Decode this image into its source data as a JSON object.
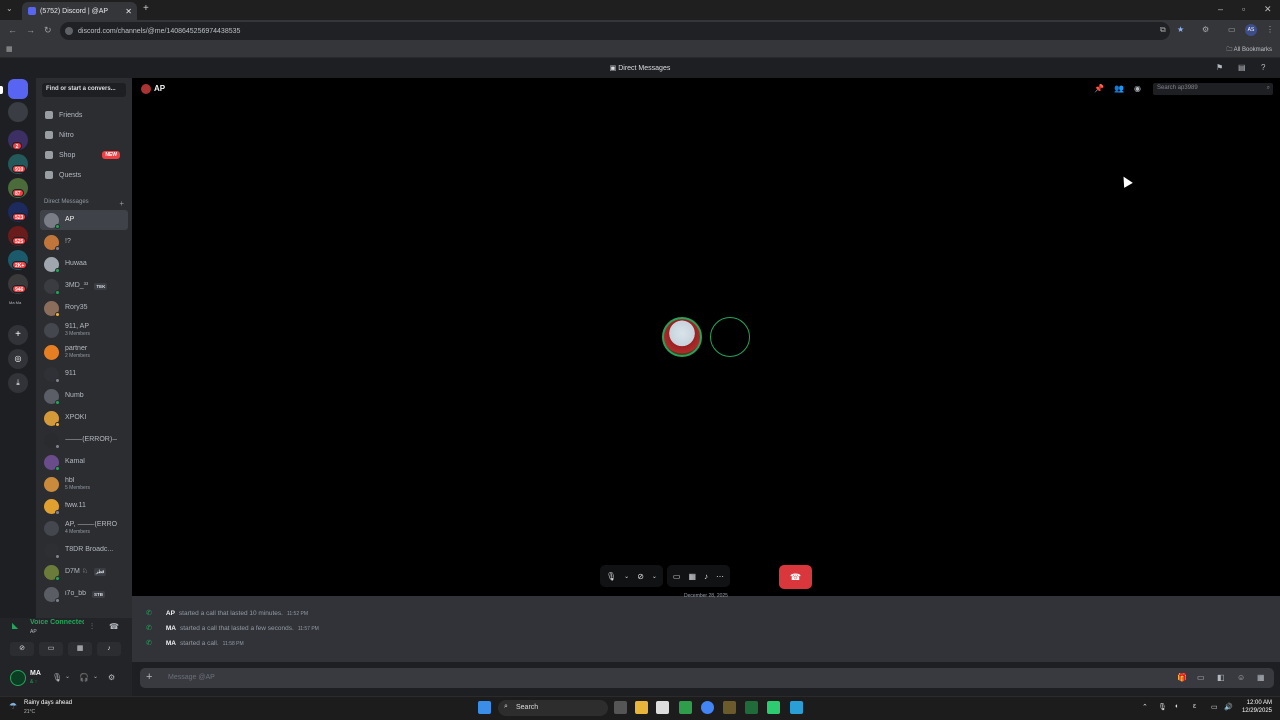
{
  "browser": {
    "tab_title": "(5752) Discord | @AP",
    "url": "discord.com/channels/@me/1408645256974438535",
    "all_bookmarks": "All Bookmarks",
    "profile_initials": "AS"
  },
  "discord": {
    "top_title": "Direct Messages",
    "find_placeholder": "Find or start a convers...",
    "nav": [
      {
        "label": "Friends"
      },
      {
        "label": "Nitro"
      },
      {
        "label": "Shop",
        "badge": "NEW"
      },
      {
        "label": "Quests"
      }
    ],
    "dm_header": "Direct Messages",
    "dm_plus": "+",
    "server_badges": [
      "2",
      "910",
      "87",
      "523",
      "525",
      "2K+",
      "946"
    ],
    "server_tiny_label": "Ma  Ma",
    "dms": [
      {
        "name": "AP",
        "sub": "",
        "tag": "",
        "color": "#7a7d86",
        "selected": true
      },
      {
        "name": "!?",
        "sub": "",
        "tag": "",
        "color": "#c0763a"
      },
      {
        "name": "Huwaa",
        "sub": "",
        "tag": "",
        "color": "#9fa6ad"
      },
      {
        "name": "3MD_³³",
        "sub": "",
        "tag": "TEK",
        "color": "#3a3c42"
      },
      {
        "name": "Rory35",
        "sub": "",
        "tag": "",
        "color": "#8a6d5a"
      },
      {
        "name": "911, AP",
        "sub": "3 Members",
        "tag": "",
        "color": "#44474e"
      },
      {
        "name": "partner",
        "sub": "2 Members",
        "tag": "",
        "color": "#e67e22"
      },
      {
        "name": "911",
        "sub": "",
        "tag": "",
        "color": "#2f3136"
      },
      {
        "name": "Numb",
        "sub": "",
        "tag": "",
        "color": "#5b5e66"
      },
      {
        "name": "XPOKI",
        "sub": "",
        "tag": "",
        "color": "#d49a3a"
      },
      {
        "name": "⸻(ERROR)⸻",
        "sub": "",
        "tag": "",
        "color": "#2a2b2f"
      },
      {
        "name": "Kamal",
        "sub": "",
        "tag": "",
        "color": "#6a4c8a"
      },
      {
        "name": "hbl",
        "sub": "5 Members",
        "tag": "",
        "color": "#c98a3c"
      },
      {
        "name": "fww.11",
        "sub": "",
        "tag": "",
        "color": "#e0a030"
      },
      {
        "name": "AP, ⸻(ERRO...",
        "sub": "4 Members",
        "tag": "",
        "color": "#44474e"
      },
      {
        "name": "T8DR Broadc...",
        "sub": "",
        "tag": "",
        "color": "#2e2f33"
      },
      {
        "name": "D7M ♘",
        "sub": "",
        "tag": "قطر",
        "color": "#6b7c3a"
      },
      {
        "name": "i7o_bb",
        "sub": "",
        "tag": "STB",
        "color": "#5a5d63"
      }
    ],
    "voice": {
      "status": "Voice Connected",
      "sub": "AP"
    },
    "user": {
      "name": "MA",
      "sub": "& ↑"
    },
    "channel": {
      "title": "AP",
      "search_placeholder": "Search ap3989"
    },
    "date_separator": "December 28, 2025",
    "call_log": [
      {
        "who": "AP",
        "text": "started a call that lasted 10 minutes.",
        "time": "11:52 PM"
      },
      {
        "who": "MA",
        "text": "started a call that lasted a few seconds.",
        "time": "11:57 PM"
      },
      {
        "who": "MA",
        "text": "started a call.",
        "time": "11:58 PM"
      }
    ],
    "message_placeholder": "Message @AP"
  },
  "taskbar": {
    "weather_title": "Rainy days ahead",
    "weather_temp": "21°C",
    "search_label": "Search",
    "time": "12:00 AM",
    "date": "12/29/2025"
  },
  "colors": {
    "accent": "#5865f2",
    "online": "#23a55a",
    "danger": "#da373c"
  }
}
